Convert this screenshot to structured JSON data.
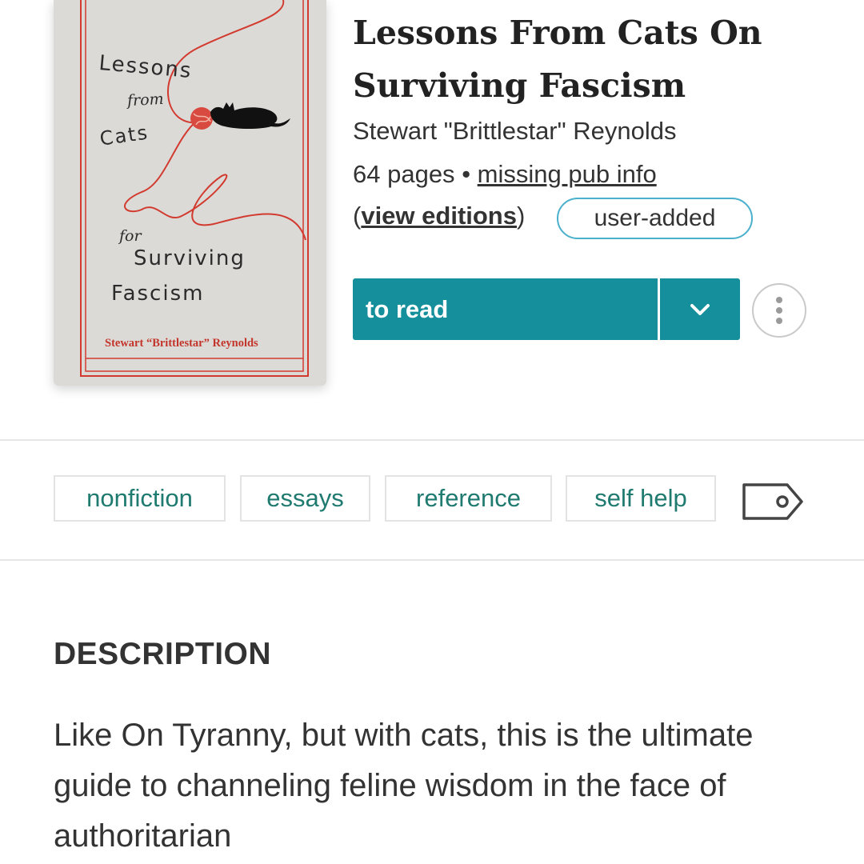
{
  "book": {
    "title": "Lessons From Cats On Surviving Fascism",
    "author": "Stewart \"Brittlestar\" Reynolds",
    "pages": "64 pages",
    "separator": "•",
    "pub_info_link": "missing pub info",
    "editions_open": "(",
    "editions_link": "view editions",
    "editions_close": ")",
    "badge": "user-added"
  },
  "cover": {
    "line_lessons": "Lessons",
    "line_from": "from",
    "line_cats": "Cats",
    "line_for": "for",
    "line_surviving": "Surviving",
    "line_fascism": "Fascism",
    "author": "Stewart “Brittlestar” Reynolds",
    "background_color": "#dcdad6",
    "line_color": "#d23a2f"
  },
  "actions": {
    "shelf_label": "to read",
    "shelf_dropdown_icon": "chevron-down-icon",
    "more_icon": "vertical-ellipsis-icon",
    "accent_color": "#158f9b"
  },
  "tags": {
    "items": [
      "nonfiction",
      "essays",
      "reference",
      "self help"
    ],
    "icon": "tag-icon",
    "color": "#1f7a70"
  },
  "description": {
    "heading": "DESCRIPTION",
    "body": "Like On Tyranny, but with cats, this is the ultimate guide to channeling feline wisdom in the face of authoritarian"
  }
}
